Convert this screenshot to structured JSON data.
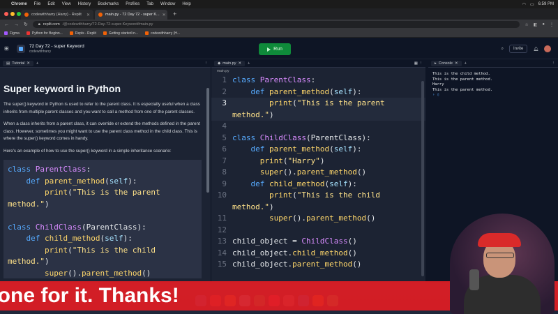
{
  "menubar": {
    "app": "Chrome",
    "items": [
      "File",
      "Edit",
      "View",
      "History",
      "Bookmarks",
      "Profiles",
      "Tab",
      "Window",
      "Help"
    ],
    "clock": "6:59 PM"
  },
  "browser": {
    "tabs": [
      {
        "title": "codewithharry (Harry) - Replit"
      },
      {
        "title": "main.py - 72 Day 72 - super K..."
      }
    ],
    "url_host": "replit.com",
    "url_path": "/@codewithharry/72-Day-72-super-Keyword#main.py",
    "bookmarks": [
      "Figma",
      "Python for Beginn...",
      "Repls - Replit",
      "Getting started in...",
      "codewithharry (H..."
    ]
  },
  "repl": {
    "title": "72 Day 72 - super Keyword",
    "owner": "codewithharry",
    "run_label": "Run",
    "invite_label": "Invite"
  },
  "tutorial": {
    "tab_label": "Tutorial",
    "heading": "Super keyword in Python",
    "paragraphs": [
      "The super() keyword in Python is used to refer to the parent class. It is especially useful when a class inherits from multiple parent classes and you want to call a method from one of the parent classes.",
      "When a class inherits from a parent class, it can override or extend the methods defined in the parent class. However, sometimes you might want to use the parent class method in the child class. This is where the super() keyword comes in handy.",
      "Here's an example of how to use the super() keyword in a simple inheritance scenario:"
    ]
  },
  "editor": {
    "tab_label": "main.py",
    "breadcrumb": "main.py",
    "active_line": 3
  },
  "console": {
    "tab_label": "Console",
    "output": [
      "This is the child method.",
      "This is the parent method.",
      "Harry",
      "This is the parent method."
    ]
  },
  "caption": {
    "text": "yone for it. Thanks!"
  },
  "colors": {
    "caption_bg": "#e01d24",
    "run_button": "#0f8a3a",
    "keyword": "#57abff",
    "class_name": "#d98cff",
    "function_name": "#ffd76b"
  }
}
